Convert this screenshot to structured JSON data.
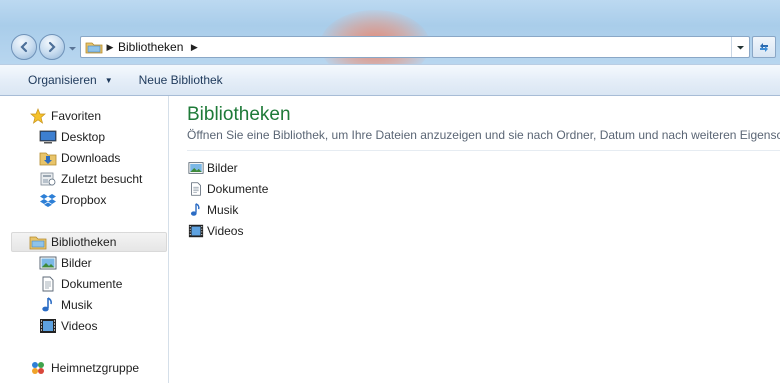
{
  "address": {
    "path_segment": "Bibliotheken",
    "icon": "library-folder-icon"
  },
  "toolbar": {
    "organize_label": "Organisieren",
    "new_library_label": "Neue Bibliothek"
  },
  "navigation": {
    "favorites": {
      "label": "Favoriten",
      "items": [
        {
          "label": "Desktop",
          "icon": "desktop-icon"
        },
        {
          "label": "Downloads",
          "icon": "downloads-icon"
        },
        {
          "label": "Zuletzt besucht",
          "icon": "recent-places-icon"
        },
        {
          "label": "Dropbox",
          "icon": "dropbox-icon"
        }
      ]
    },
    "libraries": {
      "label": "Bibliotheken",
      "items": [
        {
          "label": "Bilder",
          "icon": "pictures-icon"
        },
        {
          "label": "Dokumente",
          "icon": "documents-icon"
        },
        {
          "label": "Musik",
          "icon": "music-icon"
        },
        {
          "label": "Videos",
          "icon": "videos-icon"
        }
      ]
    },
    "homegroup": {
      "label": "Heimnetzgruppe"
    }
  },
  "content": {
    "title": "Bibliotheken",
    "subtitle": "Öffnen Sie eine Bibliothek, um Ihre Dateien anzuzeigen und sie nach Ordner, Datum und nach weiteren Eigensch",
    "items": [
      {
        "label": "Bilder",
        "icon": "pictures-icon"
      },
      {
        "label": "Dokumente",
        "icon": "documents-icon"
      },
      {
        "label": "Musik",
        "icon": "music-icon"
      },
      {
        "label": "Videos",
        "icon": "videos-icon"
      }
    ]
  },
  "colors": {
    "title_green": "#1e7a38",
    "toolbar_text": "#1e395b",
    "glass_blue": "#a9cdea"
  }
}
